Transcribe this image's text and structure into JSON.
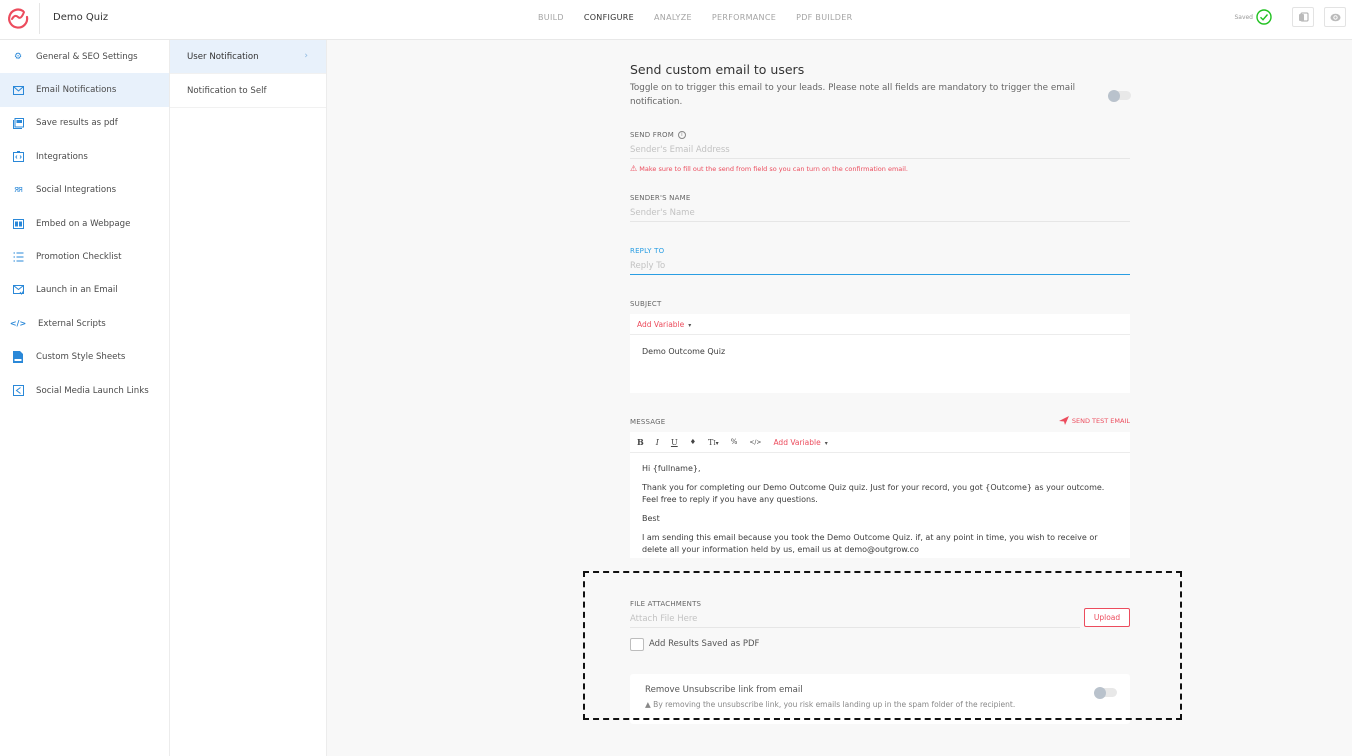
{
  "header": {
    "app_title": "Demo Quiz",
    "nav": [
      {
        "label": "BUILD",
        "active": false
      },
      {
        "label": "CONFIGURE",
        "active": true
      },
      {
        "label": "ANALYZE",
        "active": false
      },
      {
        "label": "PERFORMANCE",
        "active": false
      },
      {
        "label": "PDF BUILDER",
        "active": false
      }
    ],
    "saved_label": "Saved",
    "brand_color": "#ec4c5d",
    "saved_color": "#1fc11f"
  },
  "sidebar": {
    "items": [
      {
        "label": "General & SEO Settings",
        "icon": "gear-icon",
        "active": false
      },
      {
        "label": "Email Notifications",
        "icon": "envelope-icon",
        "active": true
      },
      {
        "label": "Save results as pdf",
        "icon": "pdf-icon",
        "active": false
      },
      {
        "label": "Integrations",
        "icon": "integrations-icon",
        "active": false
      },
      {
        "label": "Social Integrations",
        "icon": "people-icon",
        "active": false
      },
      {
        "label": "Embed on a Webpage",
        "icon": "embed-icon",
        "active": false
      },
      {
        "label": "Promotion Checklist",
        "icon": "checklist-icon",
        "active": false
      },
      {
        "label": "Launch in an Email",
        "icon": "email-launch-icon",
        "active": false
      },
      {
        "label": "External Scripts",
        "icon": "code-icon",
        "active": false
      },
      {
        "label": "Custom Style Sheets",
        "icon": "css-file-icon",
        "active": false
      },
      {
        "label": "Social Media Launch Links",
        "icon": "share-icon",
        "active": false
      }
    ]
  },
  "subnav": {
    "items": [
      {
        "label": "User Notification",
        "active": true
      },
      {
        "label": "Notification to Self",
        "active": false
      }
    ]
  },
  "main": {
    "title": "Send custom email to users",
    "description": "Toggle on to trigger this email to your leads. Please note all fields are mandatory to trigger the email notification.",
    "enabled": false,
    "send_from": {
      "label": "SEND FROM",
      "placeholder": "Sender's Email Address",
      "value": "",
      "warning": "Make sure to fill out the send from field so you can turn on the confirmation email."
    },
    "sender_name": {
      "label": "SENDER'S NAME",
      "placeholder": "Sender's Name",
      "value": ""
    },
    "reply_to": {
      "label": "REPLY TO",
      "placeholder": "Reply To",
      "value": ""
    },
    "subject": {
      "label": "SUBJECT",
      "add_variable": "Add Variable",
      "value": "Demo Outcome Quiz"
    },
    "message": {
      "label": "MESSAGE",
      "send_test": "SEND TEST EMAIL",
      "toolbar": [
        "B",
        "I",
        "U",
        "color",
        "T",
        "link",
        "code"
      ],
      "add_variable": "Add Variable",
      "paragraphs": [
        "Hi {fullname},",
        "Thank you for completing our Demo Outcome Quiz quiz. Just for your record, you got {Outcome} as your outcome. Feel free to reply if you have any questions.",
        "Best",
        "I am sending this email because you took the Demo Outcome Quiz. if, at any point in time, you wish to receive or delete all your information held by us, email us at demo@outgrow.co"
      ]
    },
    "attachments": {
      "label": "FILE ATTACHMENTS",
      "placeholder": "Attach File Here",
      "upload_label": "Upload",
      "add_pdf_label": "Add Results Saved as PDF",
      "add_pdf_checked": false
    },
    "unsubscribe": {
      "title": "Remove Unsubscribe link from email",
      "warning": "By removing the unsubscribe link, you risk emails landing up in the spam folder of the recipient.",
      "enabled": false
    }
  }
}
